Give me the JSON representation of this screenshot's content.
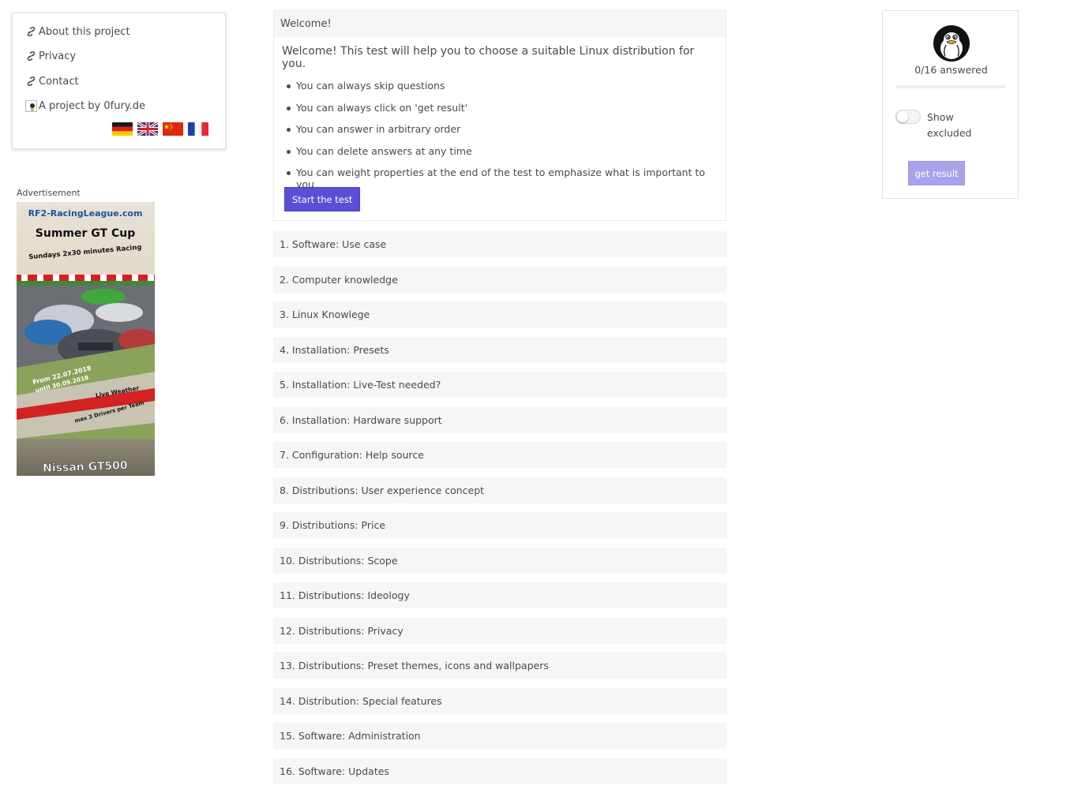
{
  "nav": {
    "items": [
      {
        "label": "About this project",
        "icon": "link-icon"
      },
      {
        "label": "Privacy",
        "icon": "link-icon"
      },
      {
        "label": "Contact",
        "icon": "link-icon"
      }
    ],
    "author_label": "A project by 0fury.de",
    "languages": [
      "German flag",
      "English flag",
      "Chinese flag",
      "French flag"
    ]
  },
  "ad": {
    "label": "Advertisement",
    "site": "RF2-RacingLeague.com",
    "headline": "Summer GT Cup",
    "schedule": "Sundays 2x30 minutes Racing",
    "dates_from": "From 22.07.2018",
    "dates_until": "until 30.09.2018",
    "weather": "Live Weather",
    "drivers": "max 3 Drivers per Team",
    "car": "Nissan GT500"
  },
  "welcome": {
    "header": "Welcome!",
    "intro": "Welcome! This test will help you to choose a suitable Linux distribution for you.",
    "rules": [
      "You can always skip questions",
      "You can always click on 'get result'",
      "You can answer in arbitrary order",
      "You can delete answers at any time",
      "You can weight properties at the end of the test to emphasize what is important to you"
    ],
    "start_label": "Start the test"
  },
  "questions": [
    "1. Software: Use case",
    "2. Computer knowledge",
    "3. Linux Knowlege",
    "4. Installation: Presets",
    "5. Installation: Live-Test needed?",
    "6. Installation: Hardware support",
    "7. Configuration: Help source",
    "8. Distributions: User experience concept",
    "9. Distributions: Price",
    "10. Distributions: Scope",
    "11. Distributions: Ideology",
    "12. Distributions: Privacy",
    "13. Distributions: Preset themes, icons and wallpapers",
    "14. Distribution: Special features",
    "15. Software: Administration",
    "16. Software: Updates"
  ],
  "progress": {
    "answered_text": "0/16 answered",
    "fraction": 0,
    "toggle_label": "Show excluded",
    "toggle_on": false,
    "result_label": "get result"
  },
  "colors": {
    "accent": "#5a4fd6",
    "accent_disabled": "#a8a3ea",
    "panel_bg": "#f5f6f8",
    "text": "#4a4a4a"
  }
}
